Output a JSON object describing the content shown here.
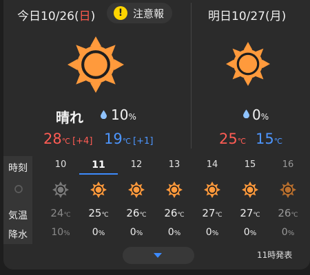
{
  "today": {
    "label_prefix": "今日10/26(",
    "dow": "日",
    "label_suffix": ")",
    "alert_label": "注意報",
    "alert_symbol": "!",
    "condition": "晴れ",
    "precip_value": "10",
    "precip_unit": "%",
    "high": "28",
    "high_unit": "℃",
    "high_diff": "[+4]",
    "low": "19",
    "low_unit": "℃",
    "low_diff": "[+1]",
    "icon": "sunny-icon"
  },
  "tomorrow": {
    "label": "明日10/27(月)",
    "precip_value": "0",
    "precip_unit": "%",
    "high": "25",
    "high_unit": "℃",
    "low": "15",
    "low_unit": "℃",
    "icon": "sunny-icon"
  },
  "hourly": {
    "row_labels": {
      "time": "時刻",
      "temp": "気温",
      "rain": "降水"
    },
    "hours": [
      {
        "hour": "10",
        "temp": "24",
        "temp_unit": "℃",
        "rain": "10",
        "rain_unit": "%",
        "icon": "sunny-icon-gray"
      },
      {
        "hour": "11",
        "temp": "25",
        "temp_unit": "℃",
        "rain": "0",
        "rain_unit": "%",
        "icon": "sunny-icon"
      },
      {
        "hour": "12",
        "temp": "26",
        "temp_unit": "℃",
        "rain": "0",
        "rain_unit": "%",
        "icon": "sunny-icon"
      },
      {
        "hour": "13",
        "temp": "26",
        "temp_unit": "℃",
        "rain": "0",
        "rain_unit": "%",
        "icon": "sunny-icon"
      },
      {
        "hour": "14",
        "temp": "27",
        "temp_unit": "℃",
        "rain": "0",
        "rain_unit": "%",
        "icon": "sunny-icon"
      },
      {
        "hour": "15",
        "temp": "27",
        "temp_unit": "℃",
        "rain": "0",
        "rain_unit": "%",
        "icon": "sunny-icon"
      },
      {
        "hour": "16",
        "temp": "26",
        "temp_unit": "℃",
        "rain": "0",
        "rain_unit": "%",
        "icon": "sunny-icon-dim"
      }
    ],
    "current_hour": "11"
  },
  "footer": {
    "issued": "11時発表",
    "expand_icon": "chevron-down-icon"
  },
  "colors": {
    "sun": "#ff9a3c",
    "sun_stroke": "#1e1e1e",
    "high": "#ff5c54",
    "low": "#4d96ff",
    "alert": "#ffd500",
    "accent": "#3d8bff"
  }
}
